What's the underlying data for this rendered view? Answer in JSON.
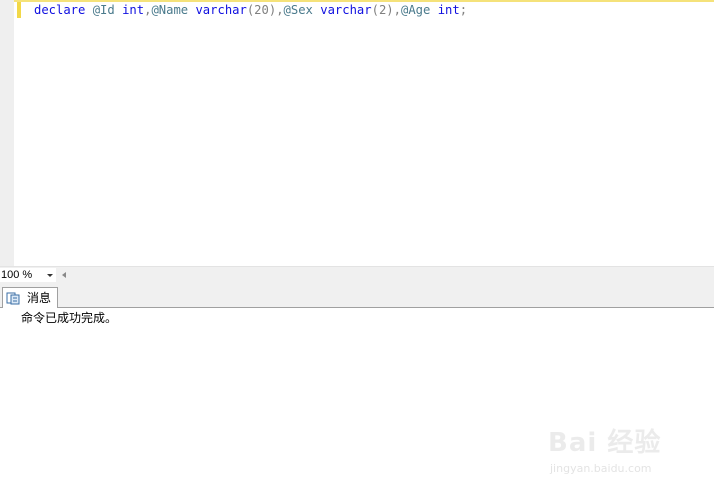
{
  "editor": {
    "code_tokens": [
      {
        "text": "declare",
        "cls": "kw"
      },
      {
        "text": " ",
        "cls": ""
      },
      {
        "text": "@Id",
        "cls": "var"
      },
      {
        "text": " ",
        "cls": ""
      },
      {
        "text": "int",
        "cls": "kw"
      },
      {
        "text": ",",
        "cls": "punc"
      },
      {
        "text": "@Name",
        "cls": "var"
      },
      {
        "text": " ",
        "cls": ""
      },
      {
        "text": "varchar",
        "cls": "kw"
      },
      {
        "text": "(20)",
        "cls": "punc"
      },
      {
        "text": ",",
        "cls": "punc"
      },
      {
        "text": "@Sex",
        "cls": "var"
      },
      {
        "text": " ",
        "cls": ""
      },
      {
        "text": "varchar",
        "cls": "kw"
      },
      {
        "text": "(2)",
        "cls": "punc"
      },
      {
        "text": ",",
        "cls": "punc"
      },
      {
        "text": "@Age",
        "cls": "var"
      },
      {
        "text": " ",
        "cls": ""
      },
      {
        "text": "int",
        "cls": "kw"
      },
      {
        "text": ";",
        "cls": "punc"
      }
    ]
  },
  "statusbar": {
    "zoom_value": "100 %"
  },
  "results": {
    "tab_label": "消息",
    "tab_icon": "messages-icon",
    "message": "命令已成功完成。"
  },
  "watermark": {
    "main": "Bai 经验",
    "sub": "jingyan.baidu.com"
  },
  "colors": {
    "keyword": "#1010e0",
    "variable": "#4a7a8c",
    "punctuation": "#808080",
    "change_marker": "#f2d848"
  }
}
